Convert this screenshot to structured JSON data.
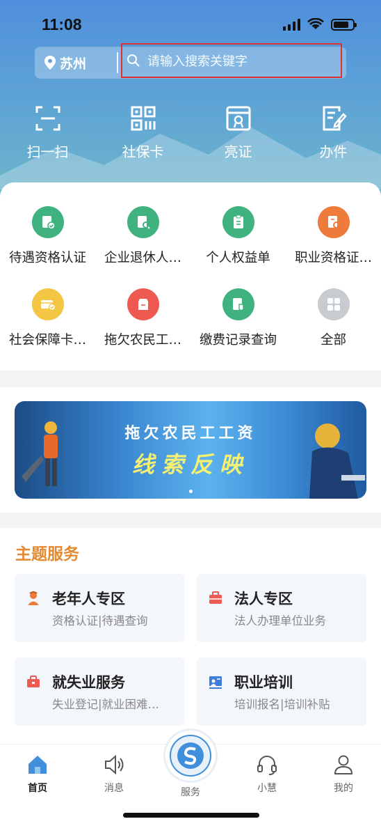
{
  "status": {
    "time": "11:08"
  },
  "search": {
    "city": "苏州",
    "placeholder": "请输入搜索关键字"
  },
  "quick_actions": [
    {
      "label": "扫一扫",
      "icon": "scan-icon"
    },
    {
      "label": "社保卡",
      "icon": "qr-card-icon"
    },
    {
      "label": "亮证",
      "icon": "certificate-icon"
    },
    {
      "label": "办件",
      "icon": "edit-doc-icon"
    }
  ],
  "services": [
    {
      "label": "待遇资格认证",
      "color": "#3fb27f"
    },
    {
      "label": "企业退休人…",
      "color": "#3fb27f"
    },
    {
      "label": "个人权益单",
      "color": "#3fb27f"
    },
    {
      "label": "职业资格证…",
      "color": "#ee7a3b"
    },
    {
      "label": "社会保障卡…",
      "color": "#f3c643"
    },
    {
      "label": "拖欠农民工…",
      "color": "#ee5a52"
    },
    {
      "label": "缴费记录查询",
      "color": "#3fb27f"
    },
    {
      "label": "全部",
      "color": "#c8cbd0"
    }
  ],
  "banner": {
    "line1": "拖欠农民工工资",
    "line2": "线索反映"
  },
  "theme": {
    "title": "主题服务",
    "cards": [
      {
        "name": "老年人专区",
        "sub": "资格认证|待遇查询",
        "icon": "elder-icon",
        "color": "#ee7a3b"
      },
      {
        "name": "法人专区",
        "sub": "法人办理单位业务",
        "icon": "briefcase-icon",
        "color": "#ee5a52"
      },
      {
        "name": "就失业服务",
        "sub": "失业登记|就业困难…",
        "icon": "toolbox-icon",
        "color": "#ee5a52"
      },
      {
        "name": "职业培训",
        "sub": "培训报名|培训补贴",
        "icon": "training-icon",
        "color": "#3f7ed8"
      }
    ]
  },
  "tabs": [
    {
      "label": "首页",
      "active": true
    },
    {
      "label": "消息"
    },
    {
      "label": "服务"
    },
    {
      "label": "小慧"
    },
    {
      "label": "我的"
    }
  ],
  "colors": {
    "accent": "#3f7ed8",
    "theme_title": "#e5892e",
    "highlight_box": "#e03131"
  }
}
